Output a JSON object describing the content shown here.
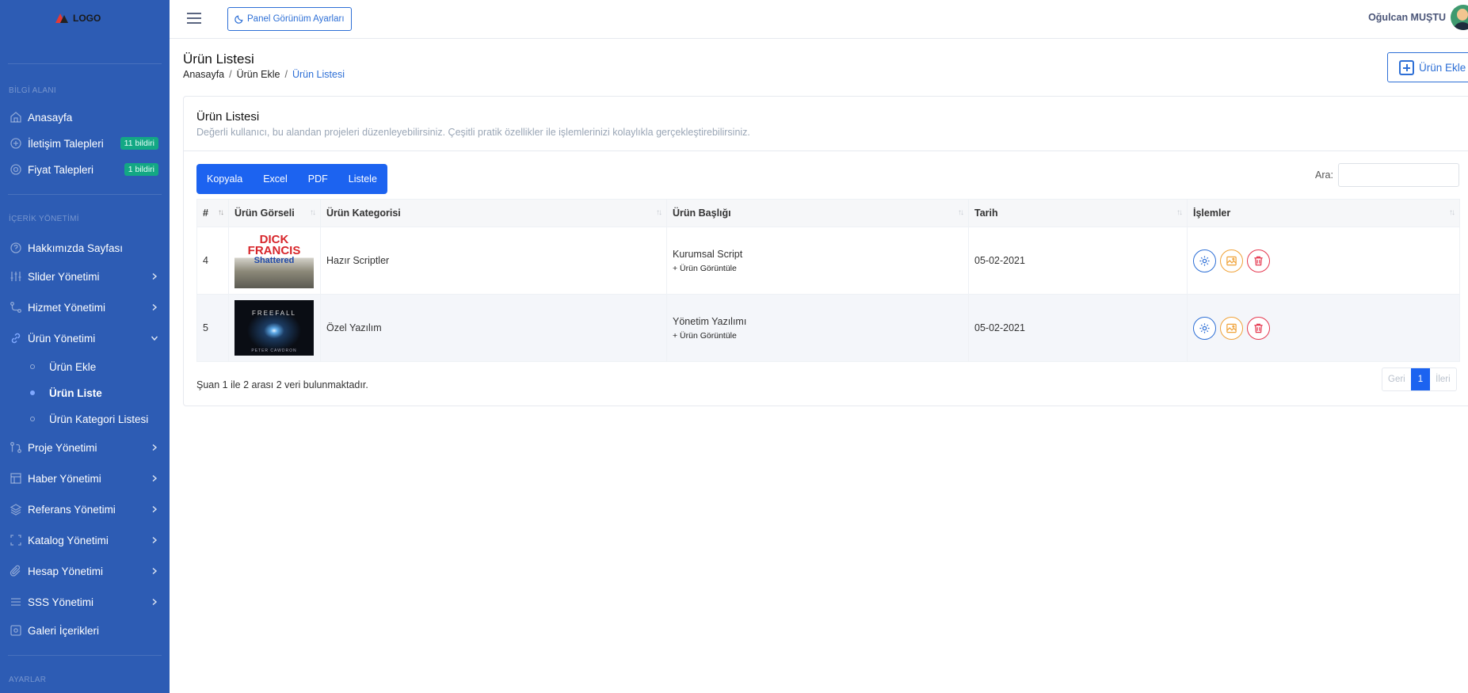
{
  "logo": {
    "text": "LOGO"
  },
  "sidebar": {
    "section_info": "BİLGİ ALANI",
    "section_content": "İÇERİK YÖNETİMİ",
    "section_settings": "AYARLAR",
    "items": [
      {
        "label": "Anasayfa",
        "icon": "home-icon"
      },
      {
        "label": "İletişim Talepleri",
        "icon": "message-icon",
        "badge": "11 bildiri"
      },
      {
        "label": "Fiyat Talepleri",
        "icon": "support-icon",
        "badge": "1 bildiri"
      },
      {
        "label": "Hakkımızda Sayfası",
        "icon": "question-icon"
      },
      {
        "label": "Slider Yönetimi",
        "icon": "sliders-icon"
      },
      {
        "label": "Hizmet Yönetimi",
        "icon": "route-icon"
      },
      {
        "label": "Ürün Yönetimi",
        "icon": "link-icon"
      },
      {
        "label": "Proje Yönetimi",
        "icon": "git-icon"
      },
      {
        "label": "Haber Yönetimi",
        "icon": "layout-icon"
      },
      {
        "label": "Referans Yönetimi",
        "icon": "layers-icon"
      },
      {
        "label": "Katalog Yönetimi",
        "icon": "frame-icon"
      },
      {
        "label": "Hesap Yönetimi",
        "icon": "paperclip-icon"
      },
      {
        "label": "SSS Yönetimi",
        "icon": "list-icon"
      },
      {
        "label": "Galeri İçerikleri",
        "icon": "gallery-icon"
      }
    ],
    "subitems": [
      {
        "label": "Ürün Ekle"
      },
      {
        "label": "Ürün Liste"
      },
      {
        "label": "Ürün Kategori Listesi"
      }
    ]
  },
  "topbar": {
    "theme_button": "Panel Görünüm Ayarları",
    "user_name": "Oğulcan MUŞTU"
  },
  "page": {
    "title": "Ürün Listesi",
    "breadcrumb": [
      "Anasayfa",
      "Ürün Ekle",
      "Ürün Listesi"
    ],
    "add_button": "Ürün Ekle"
  },
  "card": {
    "title": "Ürün Listesi",
    "description": "Değerli kullanıcı, bu alandan projeleri düzenleyebilirsiniz. Çeşitli pratik özellikler ile işlemlerinizi kolaylıkla gerçekleştirebilirsiniz.",
    "buttons": [
      "Kopyala",
      "Excel",
      "PDF",
      "Listele"
    ],
    "search_label": "Ara:",
    "search_placeholder": ""
  },
  "table": {
    "headers": [
      "#",
      "Ürün Görseli",
      "Ürün Kategorisi",
      "Ürün Başlığı",
      "Tarih",
      "İşlemler"
    ],
    "rows": [
      {
        "id": "4",
        "image_title": "DICK FRANCIS",
        "image_subtitle": "Shattered",
        "category": "Hazır Scriptler",
        "title": "Kurumsal Script",
        "view": "+ Ürün Görüntüle",
        "date": "05-02-2021"
      },
      {
        "id": "5",
        "image_title": "FREEFALL",
        "image_subtitle": "PETER CAWDRON",
        "category": "Özel Yazılım",
        "title": "Yönetim Yazılımı",
        "view": "+ Ürün Görüntüle",
        "date": "05-02-2021"
      }
    ]
  },
  "footer": {
    "info": "Şuan 1 ile 2 arası 2 veri bulunmaktadır.",
    "prev": "Geri",
    "page": "1",
    "next": "İleri"
  },
  "colors": {
    "sidebar": "#2d5cb4",
    "accent": "#1c63f0",
    "badge": "#13a884",
    "danger": "#e53950",
    "warning": "#f0a33a"
  }
}
